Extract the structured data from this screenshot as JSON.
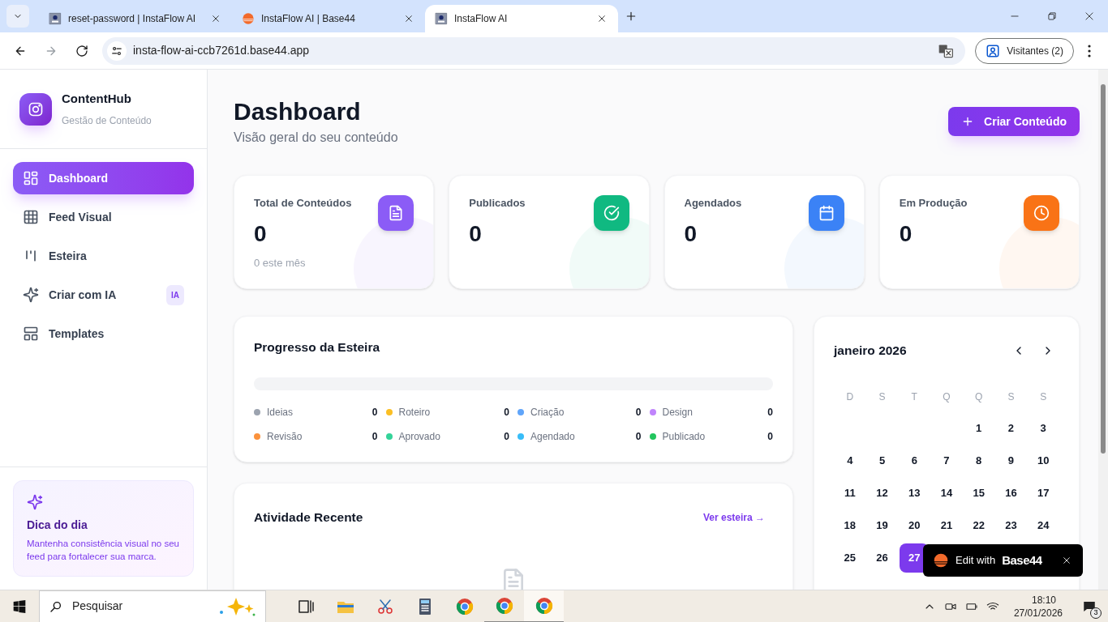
{
  "browser": {
    "tabs": [
      {
        "title": "reset-password | InstaFlow AI",
        "selected": false,
        "kind": "page"
      },
      {
        "title": "InstaFlow AI | Base44",
        "selected": false,
        "kind": "sun"
      },
      {
        "title": "InstaFlow AI",
        "selected": true,
        "kind": "page"
      }
    ],
    "url": "insta-flow-ai-ccb7261d.base44.app",
    "profile": "Visitantes (2)"
  },
  "sidebar": {
    "brand": "ContentHub",
    "subtitle": "Gestão de Conteúdo",
    "items": [
      {
        "label": "Dashboard",
        "selected": true,
        "kind": "dashboard"
      },
      {
        "label": "Feed Visual",
        "selected": false,
        "kind": "grid"
      },
      {
        "label": "Esteira",
        "selected": false,
        "kind": "columns"
      },
      {
        "label": "Criar com IA",
        "selected": false,
        "kind": "sparkles",
        "badge": "IA"
      },
      {
        "label": "Templates",
        "selected": false,
        "kind": "layout"
      }
    ],
    "tip": {
      "title": "Dica do dia",
      "text": "Mantenha consistência visual no seu feed para fortalecer sua marca."
    }
  },
  "header": {
    "title": "Dashboard",
    "subtitle": "Visão geral do seu conteúdo",
    "button": "Criar Conteúdo"
  },
  "stats": [
    {
      "label": "Total de Conteúdos",
      "value": "0",
      "note": "0 este mês",
      "kind": "file",
      "color": "#8b5cf6"
    },
    {
      "label": "Publicados",
      "value": "0",
      "kind": "check",
      "color": "#10b981"
    },
    {
      "label": "Agendados",
      "value": "0",
      "kind": "calendar",
      "color": "#3b82f6"
    },
    {
      "label": "Em Produção",
      "value": "0",
      "kind": "clock",
      "color": "#f97316"
    }
  ],
  "pipeline": {
    "title": "Progresso da Esteira",
    "level": 0,
    "stages": [
      {
        "label": "Ideias",
        "count": "0",
        "color": "#9ca3af"
      },
      {
        "label": "Roteiro",
        "count": "0",
        "color": "#fbbf24"
      },
      {
        "label": "Criação",
        "count": "0",
        "color": "#60a5fa"
      },
      {
        "label": "Design",
        "count": "0",
        "color": "#c084fc"
      },
      {
        "label": "Revisão",
        "count": "0",
        "color": "#fb923c"
      },
      {
        "label": "Aprovado",
        "count": "0",
        "color": "#34d399"
      },
      {
        "label": "Agendado",
        "count": "0",
        "color": "#38bdf8"
      },
      {
        "label": "Publicado",
        "count": "0",
        "color": "#22c55e"
      }
    ]
  },
  "activity": {
    "title": "Atividade Recente",
    "link": "Ver esteira →"
  },
  "calendar": {
    "month": "janeiro 2026",
    "weekdays": [
      "D",
      "S",
      "T",
      "Q",
      "Q",
      "S",
      "S"
    ],
    "weeks": [
      [
        {
          "label": "1",
          "selected": false
        },
        {
          "label": "2",
          "selected": false
        },
        {
          "label": "3",
          "selected": false
        }
      ],
      [
        {
          "label": "4",
          "selected": false
        },
        {
          "label": "5",
          "selected": false
        },
        {
          "label": "6",
          "selected": false
        },
        {
          "label": "7",
          "selected": false
        },
        {
          "label": "8",
          "selected": false
        },
        {
          "label": "9",
          "selected": false
        },
        {
          "label": "10",
          "selected": false
        }
      ],
      [
        {
          "label": "11",
          "selected": false
        },
        {
          "label": "12",
          "selected": false
        },
        {
          "label": "13",
          "selected": false
        },
        {
          "label": "14",
          "selected": false
        },
        {
          "label": "15",
          "selected": false
        },
        {
          "label": "16",
          "selected": false
        },
        {
          "label": "17",
          "selected": false
        }
      ],
      [
        {
          "label": "18",
          "selected": false
        },
        {
          "label": "19",
          "selected": false
        },
        {
          "label": "20",
          "selected": false
        },
        {
          "label": "21",
          "selected": false
        },
        {
          "label": "22",
          "selected": false
        },
        {
          "label": "23",
          "selected": false
        },
        {
          "label": "24",
          "selected": false
        }
      ],
      [
        {
          "label": "25",
          "selected": false
        },
        {
          "label": "26",
          "selected": false
        },
        {
          "label": "27",
          "selected": true
        }
      ]
    ]
  },
  "toast": {
    "text": "Edit with",
    "brand": "Base44"
  },
  "taskbar": {
    "search": "Pesquisar",
    "time": "18:10",
    "date": "27/01/2026",
    "notifications": "3"
  }
}
